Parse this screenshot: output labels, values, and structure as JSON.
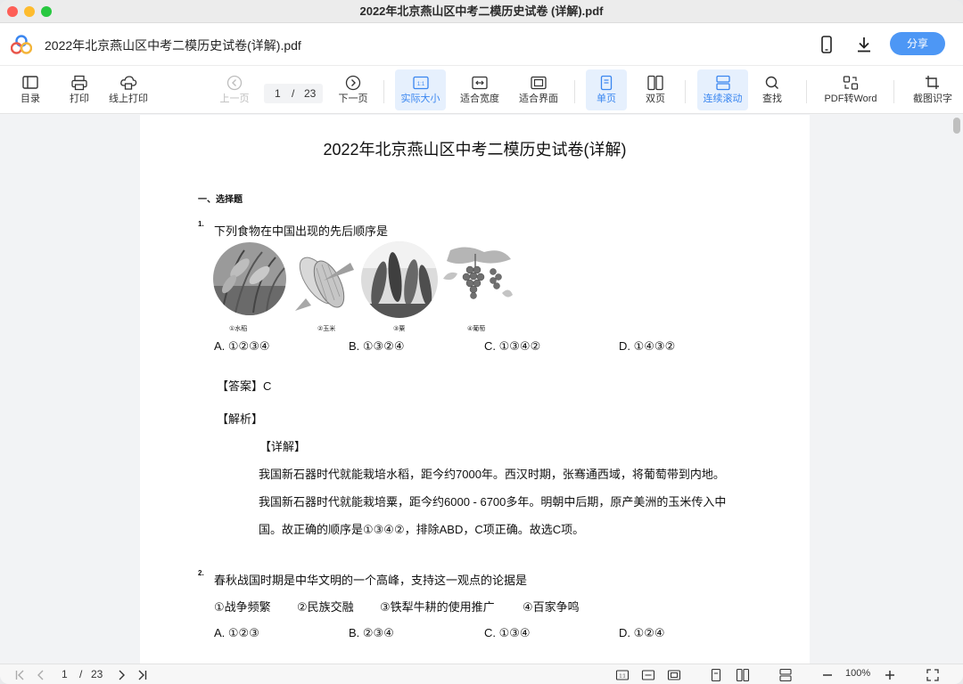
{
  "window": {
    "title": "2022年北京燕山区中考二模历史试卷 (详解).pdf"
  },
  "header": {
    "doc_name": "2022年北京燕山区中考二模历史试卷(详解).pdf",
    "share_label": "分享"
  },
  "toolbar": {
    "toc": "目录",
    "print": "打印",
    "online_print": "线上打印",
    "prev_page": "上一页",
    "current_page": "1",
    "page_sep": "/",
    "total_pages": "23",
    "next_page": "下一页",
    "actual_size": "实际大小",
    "fit_width": "适合宽度",
    "fit_page": "适合界面",
    "single_page": "单页",
    "double_page": "双页",
    "continuous": "连续滚动",
    "search": "查找",
    "pdf_to_word": "PDF转Word",
    "ocr": "截图识字"
  },
  "document": {
    "title": "2022年北京燕山区中考二模历史试卷(详解)",
    "section": "一、选择题",
    "q1": {
      "num": "1.",
      "text": "下列食物在中国出现的先后顺序是",
      "captions": [
        "①水稻",
        "②玉米",
        "③粟",
        "④葡萄"
      ],
      "options": [
        "A. ①②③④",
        "B. ①③②④",
        "C. ①③④②",
        "D. ①④③②"
      ],
      "answer": "【答案】C",
      "analysis": "【解析】",
      "detail": "【详解】",
      "line1": "我国新石器时代就能栽培水稻，距今约7000年。西汉时期，张骞通西域，将葡萄带到内地。",
      "line2": "我国新石器时代就能栽培粟，距今约6000 - 6700多年。明朝中后期，原产美洲的玉米传入中",
      "line3": "国。故正确的顺序是①③④②，排除ABD，C项正确。故选C项。"
    },
    "q2": {
      "num": "2.",
      "text": "春秋战国时期是中华文明的一个高峰，支持这一观点的论据是",
      "items": [
        "①战争频繁",
        "②民族交融",
        "③铁犁牛耕的使用推广",
        "④百家争鸣"
      ],
      "options": [
        "A. ①②③",
        "B. ②③④",
        "C. ①③④",
        "D. ①②④"
      ]
    }
  },
  "statusbar": {
    "current_page": "1",
    "page_sep": "/",
    "total_pages": "23",
    "zoom": "100%"
  },
  "colors": {
    "accent": "#4d97f5",
    "active_bg": "#e6f0fd"
  }
}
